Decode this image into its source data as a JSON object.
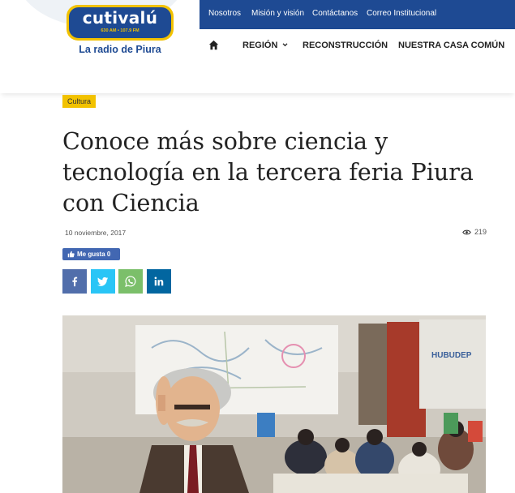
{
  "logo": {
    "name": "cutivalú",
    "frequency": "630 AM • 107.9 FM",
    "tagline": "La radio de Piura"
  },
  "topbar": {
    "links": [
      "Nosotros",
      "Misión y visión",
      "Contáctanos",
      "Correo Institucional"
    ]
  },
  "nav": {
    "home_icon": "home-icon",
    "items": [
      "REGIÓN",
      "RECONSTRUCCIÓN",
      "NUESTRA CASA COMÚN"
    ],
    "region_dropdown_icon": "chevron-down-icon"
  },
  "article": {
    "category": "Cultura",
    "title": "Conoce más sobre ciencia y tecnología en la tercera feria Piura con Ciencia",
    "date": "10 noviembre, 2017",
    "views": "219",
    "like_label": "Me gusta 0",
    "share": {
      "facebook": "facebook-icon",
      "twitter": "twitter-icon",
      "whatsapp": "whatsapp-icon",
      "linkedin": "linkedin-icon"
    },
    "photo_sign": "HUBUDEP"
  },
  "colors": {
    "brand_blue": "#1e4a93",
    "brand_yellow": "#f2c200",
    "facebook": "#516eab",
    "twitter": "#29c5f6",
    "whatsapp": "#7bbf6a",
    "linkedin": "#0266a0",
    "like_button": "#4267b2"
  }
}
